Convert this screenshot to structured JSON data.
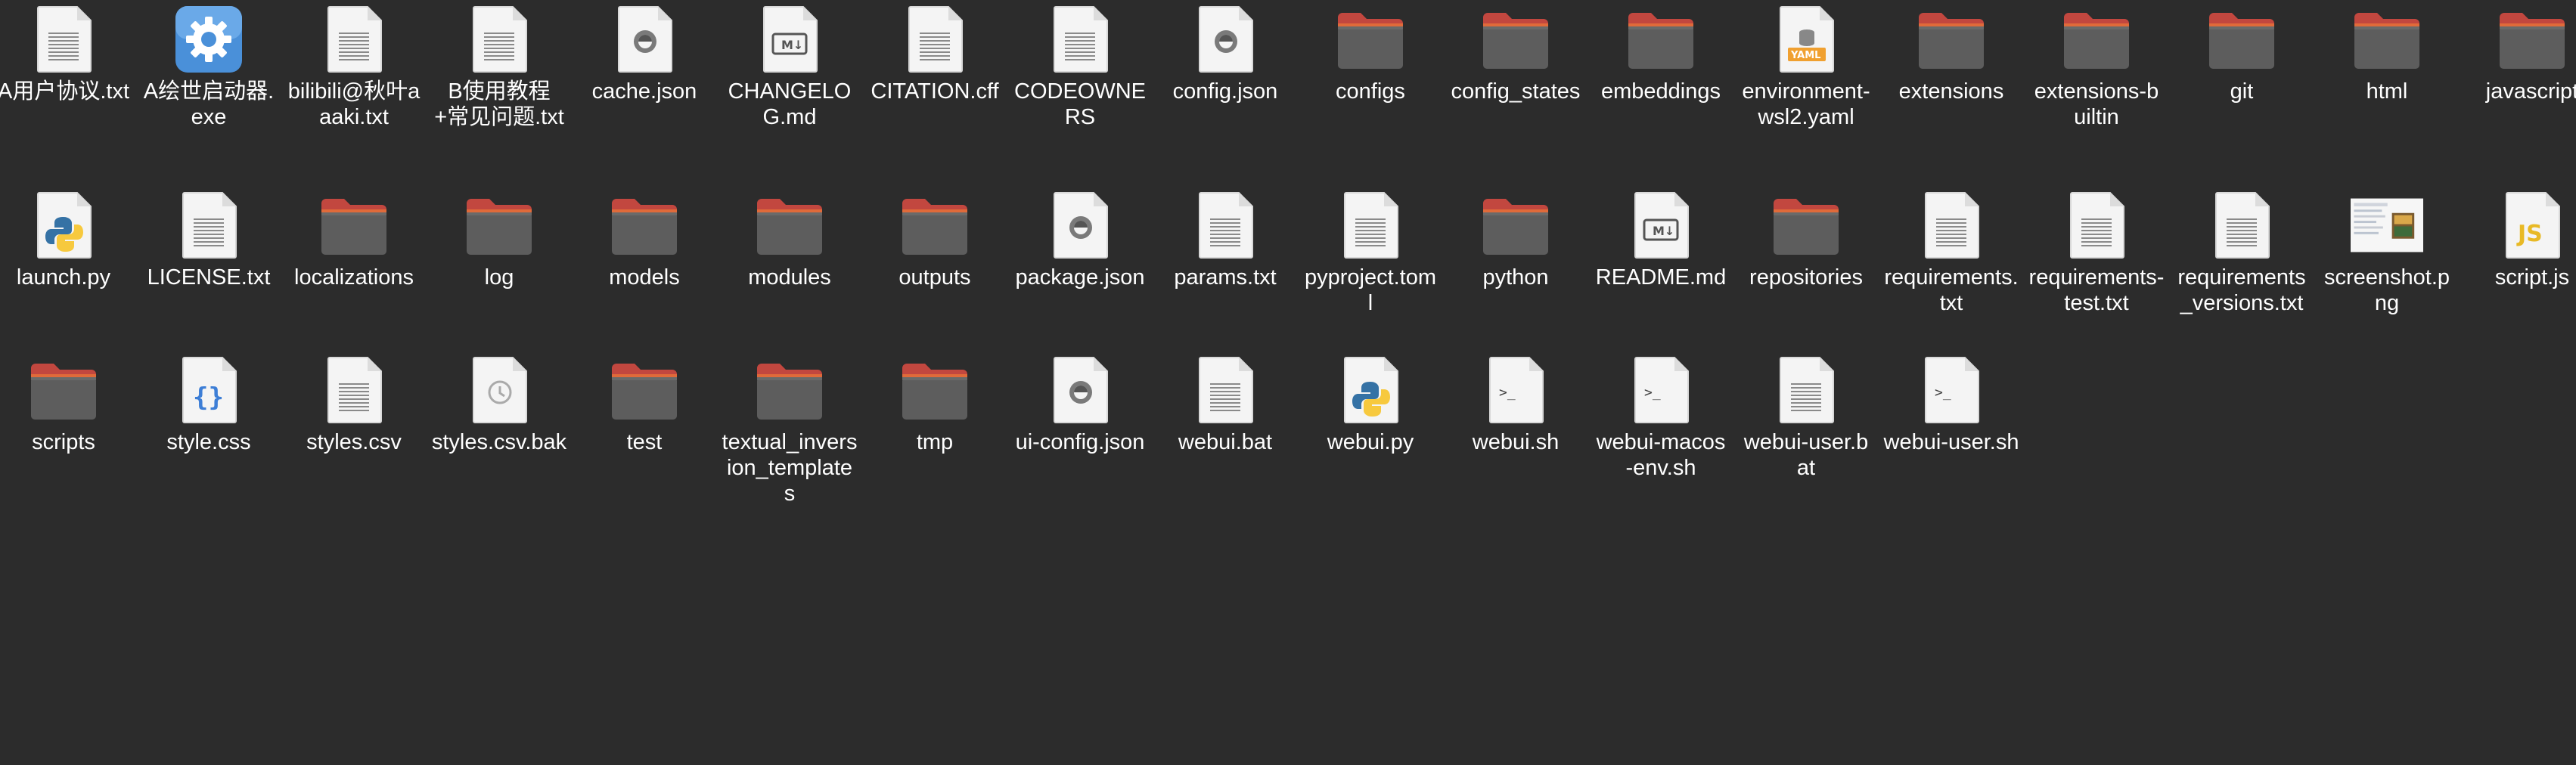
{
  "files": [
    {
      "label": "A用户协议.txt",
      "icon": "text-file-icon"
    },
    {
      "label": "A绘世启动器.exe",
      "icon": "gear-app-icon"
    },
    {
      "label": "bilibili@秋叶aaaki.txt",
      "icon": "text-file-icon"
    },
    {
      "label": "B使用教程+常见问题.txt",
      "icon": "text-file-icon"
    },
    {
      "label": "cache.json",
      "icon": "json-file-icon"
    },
    {
      "label": "CHANGELOG.md",
      "icon": "markdown-file-icon"
    },
    {
      "label": "CITATION.cff",
      "icon": "text-file-icon"
    },
    {
      "label": "CODEOWNERS",
      "icon": "text-file-icon"
    },
    {
      "label": "config.json",
      "icon": "json-file-icon"
    },
    {
      "label": "configs",
      "icon": "folder-icon"
    },
    {
      "label": "config_states",
      "icon": "folder-icon"
    },
    {
      "label": "embeddings",
      "icon": "folder-icon"
    },
    {
      "label": "environment-wsl2.yaml",
      "icon": "yaml-file-icon"
    },
    {
      "label": "extensions",
      "icon": "folder-icon"
    },
    {
      "label": "extensions-builtin",
      "icon": "folder-icon"
    },
    {
      "label": "git",
      "icon": "folder-icon"
    },
    {
      "label": "html",
      "icon": "folder-icon"
    },
    {
      "label": "javascript",
      "icon": "folder-icon"
    },
    {
      "label": "launch.py",
      "icon": "python-file-icon"
    },
    {
      "label": "LICENSE.txt",
      "icon": "text-file-icon"
    },
    {
      "label": "localizations",
      "icon": "folder-icon"
    },
    {
      "label": "log",
      "icon": "folder-icon"
    },
    {
      "label": "models",
      "icon": "folder-icon"
    },
    {
      "label": "modules",
      "icon": "folder-icon"
    },
    {
      "label": "outputs",
      "icon": "folder-icon"
    },
    {
      "label": "package.json",
      "icon": "json-file-icon"
    },
    {
      "label": "params.txt",
      "icon": "text-file-icon"
    },
    {
      "label": "pyproject.toml",
      "icon": "text-file-icon"
    },
    {
      "label": "python",
      "icon": "folder-icon"
    },
    {
      "label": "README.md",
      "icon": "markdown-file-icon"
    },
    {
      "label": "repositories",
      "icon": "folder-icon"
    },
    {
      "label": "requirements.txt",
      "icon": "text-file-icon"
    },
    {
      "label": "requirements-test.txt",
      "icon": "text-file-icon"
    },
    {
      "label": "requirements_versions.txt",
      "icon": "text-file-icon"
    },
    {
      "label": "screenshot.png",
      "icon": "image-thumbnail-icon"
    },
    {
      "label": "script.js",
      "icon": "javascript-file-icon"
    },
    {
      "label": "scripts",
      "icon": "folder-icon"
    },
    {
      "label": "style.css",
      "icon": "css-file-icon"
    },
    {
      "label": "styles.csv",
      "icon": "text-file-icon"
    },
    {
      "label": "styles.csv.bak",
      "icon": "backup-file-icon"
    },
    {
      "label": "test",
      "icon": "folder-icon"
    },
    {
      "label": "textual_inversion_templates",
      "icon": "folder-icon"
    },
    {
      "label": "tmp",
      "icon": "folder-icon"
    },
    {
      "label": "ui-config.json",
      "icon": "json-file-icon"
    },
    {
      "label": "webui.bat",
      "icon": "text-file-icon"
    },
    {
      "label": "webui.py",
      "icon": "python-file-icon"
    },
    {
      "label": "webui.sh",
      "icon": "shell-script-icon"
    },
    {
      "label": "webui-macos-env.sh",
      "icon": "shell-script-icon"
    },
    {
      "label": "webui-user.bat",
      "icon": "text-file-icon"
    },
    {
      "label": "webui-user.sh",
      "icon": "shell-script-icon"
    }
  ],
  "colors": {
    "background": "#2c2c2c",
    "folder_body": "#5d5d5d",
    "folder_tab": "#c2473f",
    "label_text": "#ffffff"
  }
}
